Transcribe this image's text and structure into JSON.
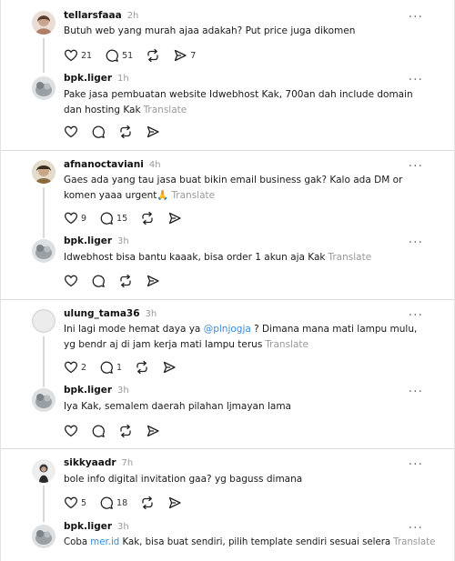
{
  "threads": [
    {
      "post": {
        "user": "tellarsfaaa",
        "time": "2h",
        "text": "Butuh web yang murah ajaa adakah? Put price juga dikomen",
        "likes": "21",
        "comments": "51",
        "shares": "7"
      },
      "reply": {
        "user": "bpk.liger",
        "time": "1h",
        "text": "Pake jasa pembuatan website Idwebhost Kak, 700an dah include domain dan hosting Kak",
        "translate": "Translate"
      }
    },
    {
      "post": {
        "user": "afnanoctaviani",
        "time": "4h",
        "text": "Gaes ada yang tau jasa buat bikin email business gak? Kalo ada DM or komen yaaa urgent🙏",
        "translate": "Translate",
        "likes": "9",
        "comments": "15"
      },
      "reply": {
        "user": "bpk.liger",
        "time": "3h",
        "text": "Idwebhost bisa bantu kaaak, bisa order 1 akun aja Kak",
        "translate": "Translate"
      }
    },
    {
      "post": {
        "user": "ulung_tama36",
        "time": "3h",
        "text_before": "Ini lagi mode hemat daya ya ",
        "mention": "@plnjogja",
        "text_after": " ? Dimana mana mati lampu mulu, yg bendr aj di jam kerja mati lampu terus",
        "translate": "Translate",
        "likes": "2",
        "comments": "1"
      },
      "reply": {
        "user": "bpk.liger",
        "time": "3h",
        "text": "Iya Kak, semalem daerah pilahan ljmayan lama"
      }
    },
    {
      "post": {
        "user": "sikkyaadr",
        "time": "7h",
        "text": "bole info digital invitation gaa? yg baguss dimana",
        "likes": "5",
        "comments": "18"
      },
      "reply": {
        "user": "bpk.liger",
        "time": "3h",
        "text_before": "Coba ",
        "link": "mer.id",
        "text_after": " Kak, bisa buat sendiri, pilih template sendiri sesuai selera",
        "translate": "Translate"
      }
    }
  ],
  "more_label": "···",
  "icons": {
    "like": "heart-icon",
    "comment": "comment-icon",
    "repost": "repost-icon",
    "share": "share-icon",
    "more": "more-icon"
  },
  "colors": {
    "link": "#3a8ad8",
    "muted": "#999999",
    "divider": "#dcdcdc"
  }
}
